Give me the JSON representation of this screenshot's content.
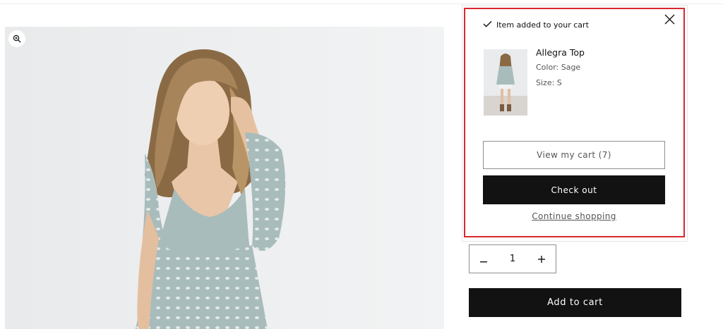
{
  "product": {
    "zoom_icon": "zoom-in-icon",
    "image_alt": "Model wearing sage eyelet ruffle top",
    "quantity": "1",
    "quantity_decrease_icon": "minus-icon",
    "quantity_increase_icon": "plus-icon",
    "add_to_cart_label": "Add to cart"
  },
  "cart_notification": {
    "heading": "Item added to your cart",
    "heading_icon": "check-icon",
    "close_icon": "close-icon",
    "item": {
      "name": "Allegra Top",
      "color": "Color: Sage",
      "size": "Size: S"
    },
    "view_cart_label": "View my cart (7)",
    "checkout_label": "Check out",
    "continue_label": "Continue shopping"
  },
  "colors": {
    "primary_button": "#121212",
    "highlight_border": "#d9282f",
    "garment": "#a9bcbc"
  }
}
